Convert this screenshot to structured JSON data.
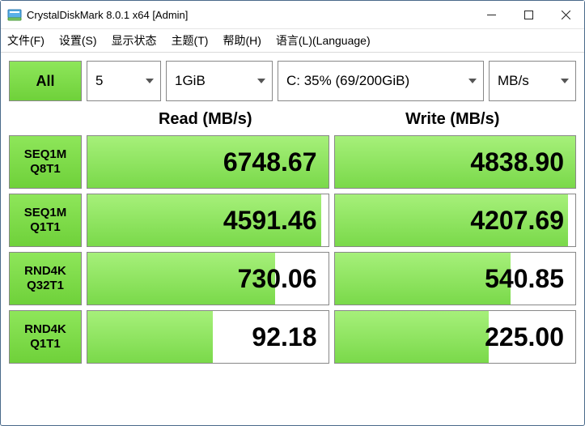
{
  "window": {
    "title": "CrystalDiskMark 8.0.1 x64 [Admin]"
  },
  "menu": {
    "file": "文件(F)",
    "settings": "设置(S)",
    "display": "显示状态",
    "theme": "主题(T)",
    "help": "帮助(H)",
    "language": "语言(L)(Language)"
  },
  "controls": {
    "all": "All",
    "count": "5",
    "size": "1GiB",
    "drive": "C: 35% (69/200GiB)",
    "unit": "MB/s"
  },
  "headers": {
    "read": "Read (MB/s)",
    "write": "Write (MB/s)"
  },
  "tests": [
    {
      "label1": "SEQ1M",
      "label2": "Q8T1",
      "read": "6748.67",
      "write": "4838.90",
      "readbar": 100,
      "writebar": 100
    },
    {
      "label1": "SEQ1M",
      "label2": "Q1T1",
      "read": "4591.46",
      "write": "4207.69",
      "readbar": 97,
      "writebar": 97
    },
    {
      "label1": "RND4K",
      "label2": "Q32T1",
      "read": "730.06",
      "write": "540.85",
      "readbar": 78,
      "writebar": 73
    },
    {
      "label1": "RND4K",
      "label2": "Q1T1",
      "read": "92.18",
      "write": "225.00",
      "readbar": 52,
      "writebar": 64
    }
  ]
}
